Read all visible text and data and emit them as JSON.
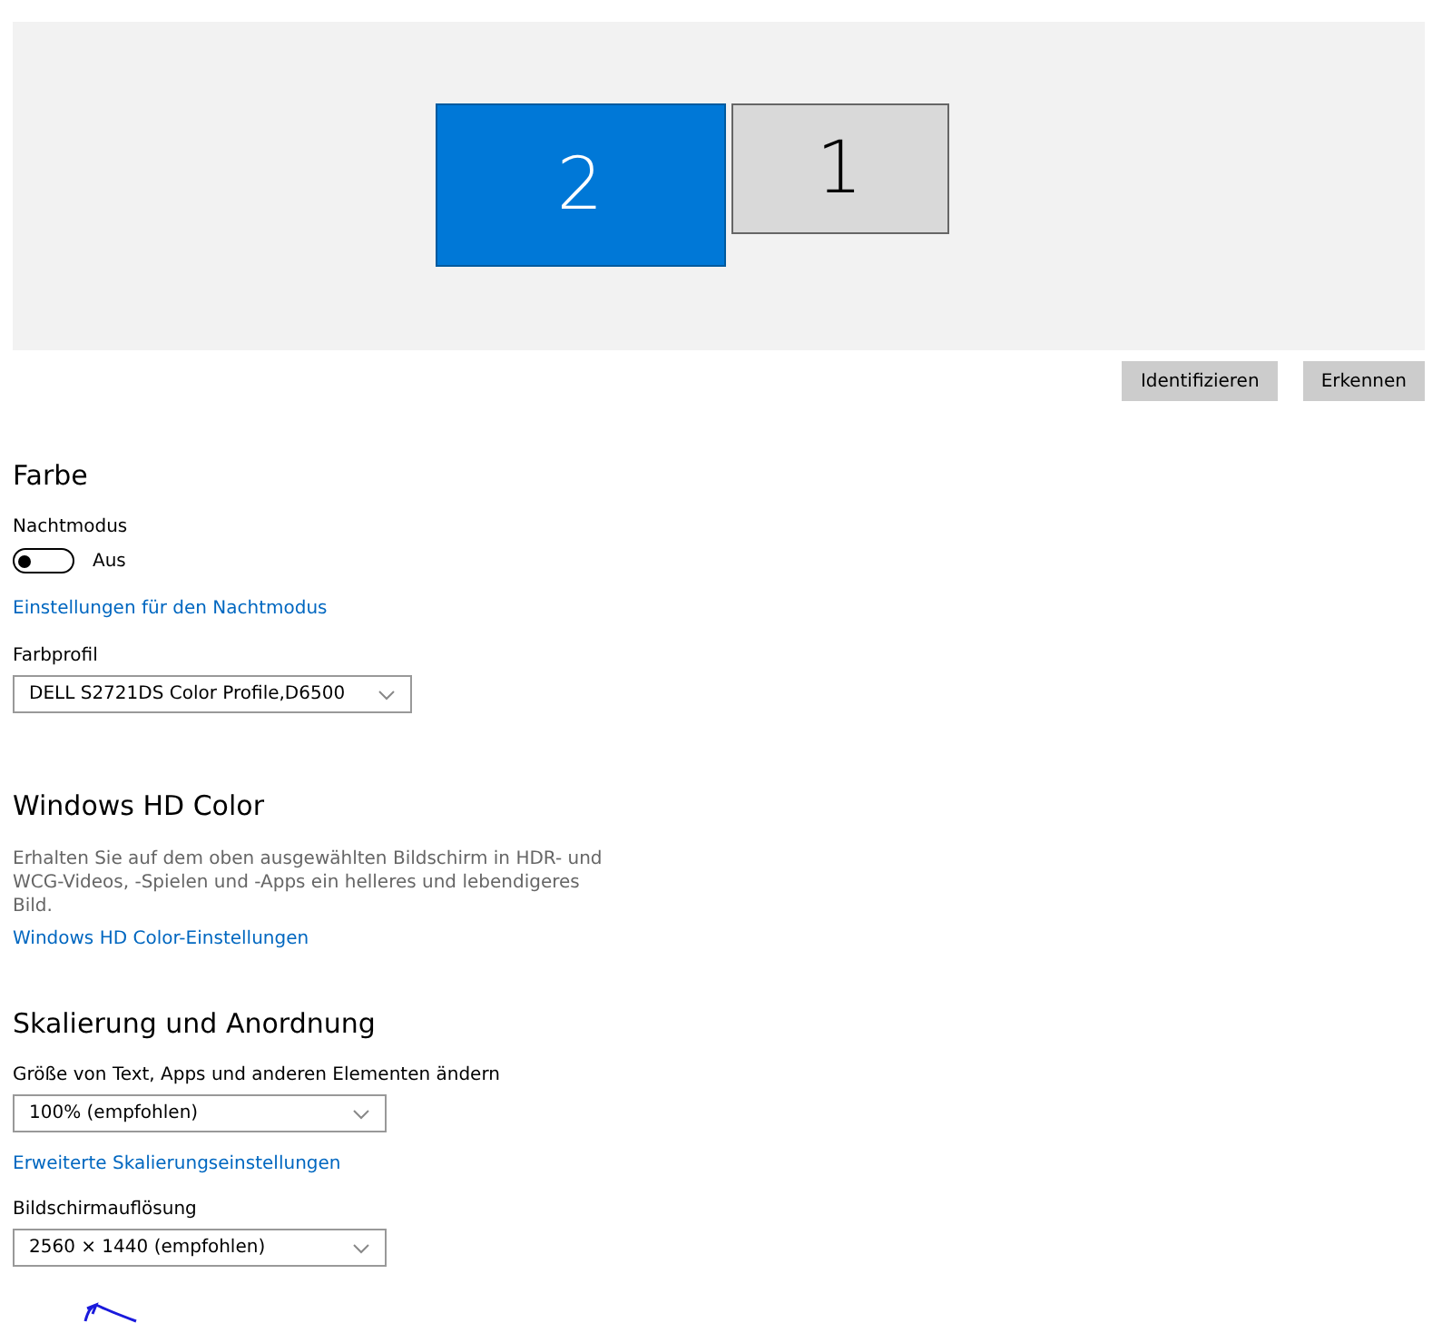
{
  "display_arrangement": {
    "monitors": [
      {
        "label": "2",
        "selected": true
      },
      {
        "label": "1",
        "selected": false
      }
    ],
    "buttons": [
      "Identifizieren",
      "Erkennen"
    ]
  },
  "color_section": {
    "heading": "Farbe",
    "night_mode": {
      "label": "Nachtmodus",
      "on": false,
      "state_text": "Aus"
    },
    "link": "Einstellungen für den Nachtmodus",
    "profile": {
      "label": "Farbprofil",
      "value": "DELL S2721DS Color Profile,D6500"
    }
  },
  "hd_color": {
    "heading": "Windows HD Color",
    "description": "Erhalten Sie auf dem oben ausgewählten Bildschirm in HDR- und WCG-Videos, -Spielen und -Apps ein helleres und lebendigeres Bild.",
    "link": "Windows HD Color-Einstellungen"
  },
  "scaling": {
    "heading": "Skalierung und Anordnung",
    "scale": {
      "label": "Größe von Text, Apps und anderen Elementen ändern",
      "value": "100% (empfohlen)"
    },
    "link": "Erweiterte Skalierungseinstellungen",
    "resolution": {
      "label": "Bildschirmauflösung",
      "value": "2560 × 1440 (empfohlen)"
    }
  }
}
